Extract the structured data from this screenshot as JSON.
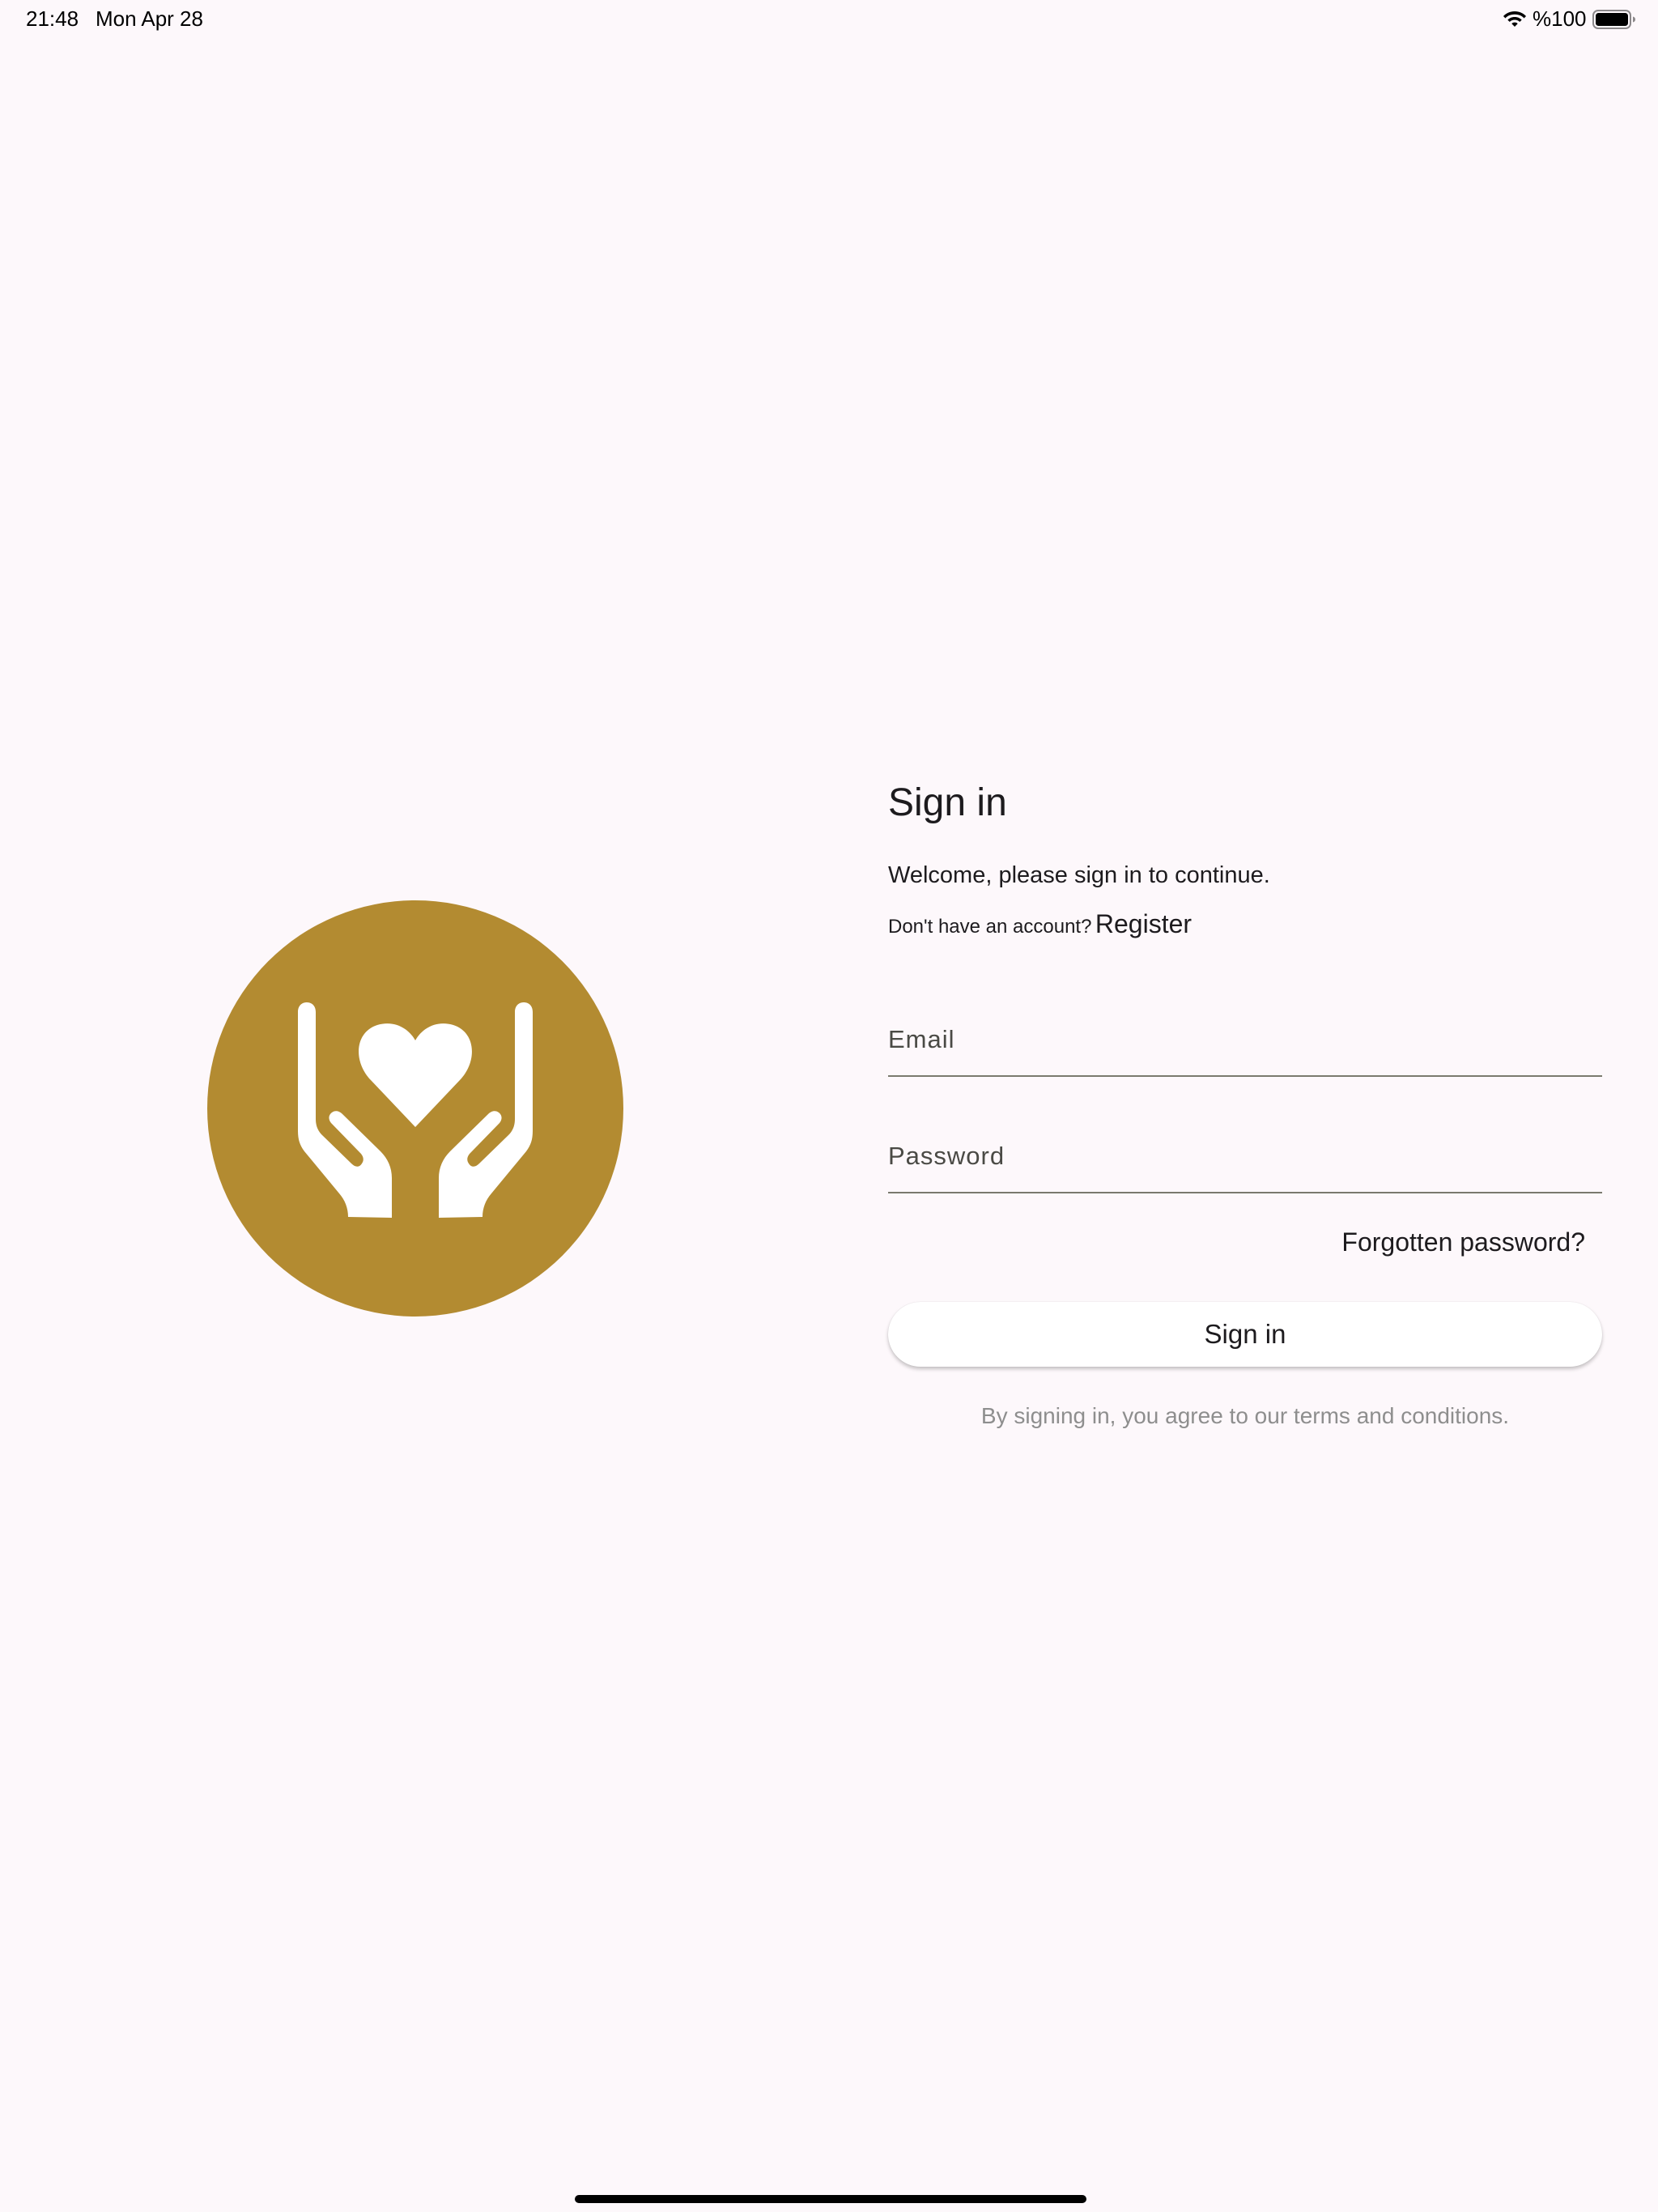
{
  "status_bar": {
    "time": "21:48",
    "date": "Mon Apr 28",
    "battery_percent": "%100",
    "wifi_icon": "wifi-icon",
    "battery_icon": "battery-full-icon"
  },
  "logo": {
    "icon": "hands-holding-heart-icon",
    "circle_color": "#b38b31",
    "icon_color": "#ffffff"
  },
  "signin": {
    "title": "Sign in",
    "welcome": "Welcome, please sign in to continue.",
    "no_account": "Don't have an account?",
    "register_label": "Register",
    "email_placeholder": "Email",
    "email_value": "",
    "password_placeholder": "Password",
    "password_value": "",
    "forgot_label": "Forgotten password?",
    "button_label": "Sign in",
    "terms": "By signing in, you agree to our terms and conditions."
  },
  "colors": {
    "background": "#fdf8fb",
    "accent": "#b38b31",
    "text": "#1d1b1e",
    "muted_text": "#8e8e8e"
  }
}
